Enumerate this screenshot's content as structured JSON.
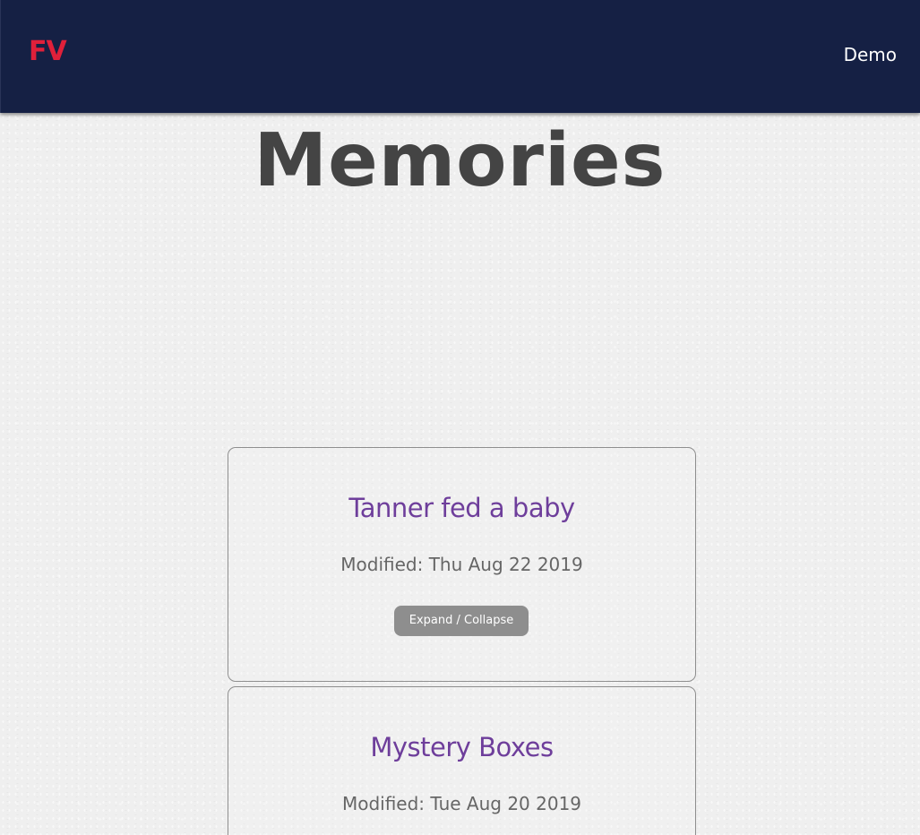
{
  "navbar": {
    "logo_text": "FV",
    "demo_link": "Demo",
    "colors": {
      "background": "#152044",
      "logo": "#e0203a"
    }
  },
  "page": {
    "title": "Memories"
  },
  "memories": [
    {
      "title": "Tanner fed a baby",
      "modified": "Modified: Thu Aug 22 2019",
      "toggle_label": "Expand / Collapse"
    },
    {
      "title": "Mystery Boxes",
      "modified": "Modified: Tue Aug 20 2019"
    }
  ],
  "colors": {
    "card_title": "#6e3e9b",
    "button": "#8e8e8e",
    "heading": "#444444"
  }
}
